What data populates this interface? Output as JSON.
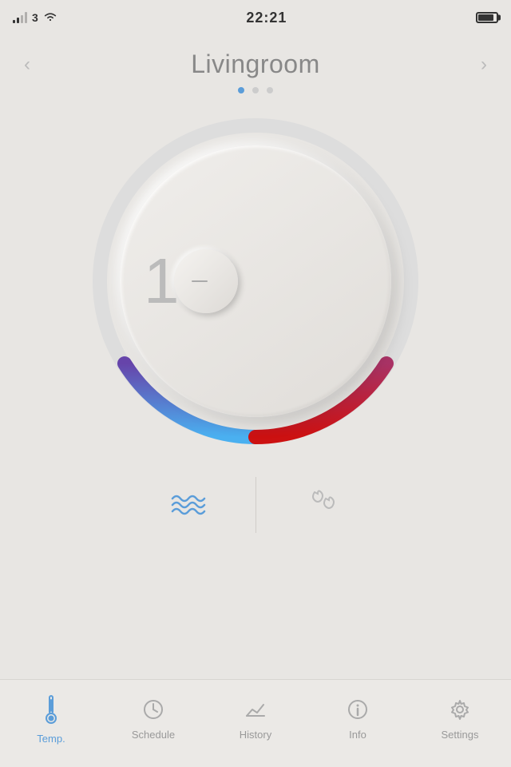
{
  "statusBar": {
    "signal": "3",
    "time": "22:21",
    "battery": 85
  },
  "header": {
    "roomName": "Livingroom",
    "prevArrow": "‹",
    "nextArrow": "›"
  },
  "dots": [
    {
      "active": true
    },
    {
      "active": false
    },
    {
      "active": false
    }
  ],
  "thermostat": {
    "temperature": "18°",
    "minTemp": 5,
    "maxTemp": 35,
    "currentTemp": 18
  },
  "controls": [
    {
      "id": "wave",
      "label": "wave"
    },
    {
      "id": "drops",
      "label": "drops"
    }
  ],
  "tabs": [
    {
      "id": "temp",
      "label": "Temp.",
      "active": true
    },
    {
      "id": "schedule",
      "label": "Schedule",
      "active": false
    },
    {
      "id": "history",
      "label": "History",
      "active": false
    },
    {
      "id": "info",
      "label": "Info",
      "active": false
    },
    {
      "id": "settings",
      "label": "Settings",
      "active": false
    }
  ],
  "colors": {
    "activeTab": "#5b9dd9",
    "inactiveTab": "#aaa",
    "tabLabel": "#999",
    "activeTabLabel": "#5b9dd9"
  }
}
